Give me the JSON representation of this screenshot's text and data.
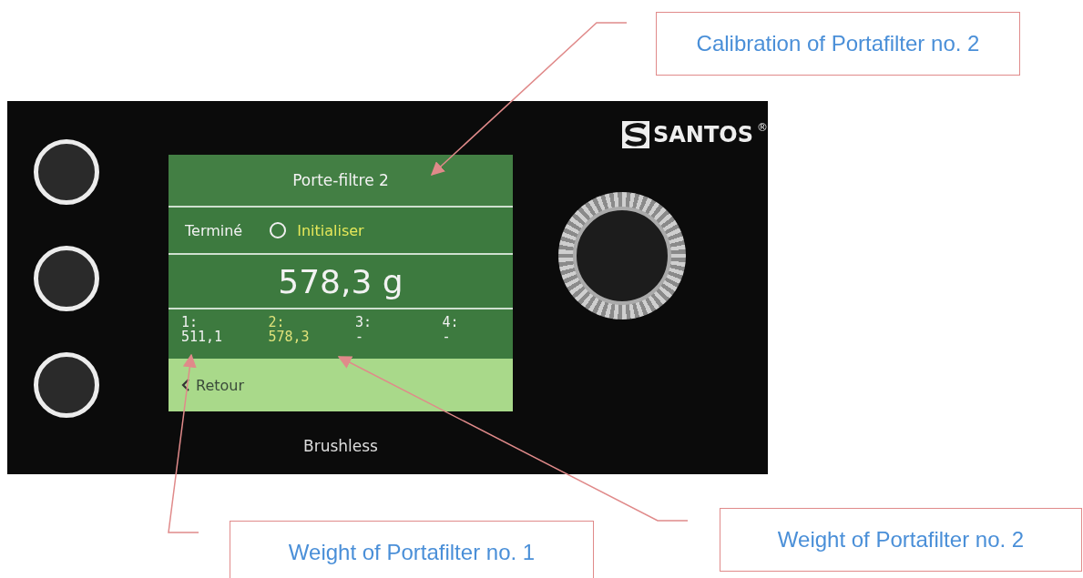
{
  "device": {
    "brand": "SANTOS",
    "registered_mark": "®",
    "model": "Brushless"
  },
  "screen": {
    "title": "Porte-filtre 2",
    "status": "Terminé",
    "option": {
      "label": "Initialiser",
      "selected": false
    },
    "weight": "578,3 g",
    "slots": [
      {
        "label": "1:",
        "value": "511,1",
        "selected": false
      },
      {
        "label": "2:",
        "value": "578,3",
        "selected": true
      },
      {
        "label": "3:",
        "value": "-",
        "selected": false
      },
      {
        "label": "4:",
        "value": "-",
        "selected": false
      }
    ],
    "back": "Retour"
  },
  "annotations": [
    {
      "text": "Calibration of Portafilter no. 2"
    },
    {
      "text": "Weight of Portafilter no. 1"
    },
    {
      "text": "Weight of Portafilter no. 2"
    }
  ]
}
